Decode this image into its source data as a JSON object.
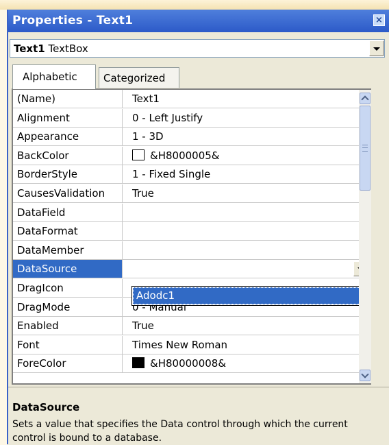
{
  "window": {
    "title": "Properties - Text1",
    "close_glyph": "×"
  },
  "object_selector": {
    "name": "Text1",
    "type": "TextBox"
  },
  "tabs": [
    {
      "label": "Alphabetic",
      "active": true
    },
    {
      "label": "Categorized",
      "active": false
    }
  ],
  "properties": [
    {
      "name": "(Name)",
      "value": "Text1"
    },
    {
      "name": "Alignment",
      "value": "0 - Left Justify"
    },
    {
      "name": "Appearance",
      "value": "1 - 3D"
    },
    {
      "name": "BackColor",
      "value": "&H8000005&",
      "swatch": "#ffffff"
    },
    {
      "name": "BorderStyle",
      "value": "1 - Fixed Single"
    },
    {
      "name": "CausesValidation",
      "value": "True"
    },
    {
      "name": "DataField",
      "value": ""
    },
    {
      "name": "DataFormat",
      "value": ""
    },
    {
      "name": "DataMember",
      "value": ""
    },
    {
      "name": "DataSource",
      "value": "",
      "selected": true
    },
    {
      "name": "DragIcon",
      "value": ""
    },
    {
      "name": "DragMode",
      "value": "0 - Manual"
    },
    {
      "name": "Enabled",
      "value": "True"
    },
    {
      "name": "Font",
      "value": "Times New Roman"
    },
    {
      "name": "ForeColor",
      "value": "&H80000008&",
      "swatch": "#000000"
    }
  ],
  "datasource_dropdown": {
    "selected_option": "Adodc1"
  },
  "description": {
    "title": "DataSource",
    "text": "Sets a value that specifies the Data control through which the current control is bound to a database."
  },
  "colors": {
    "title_bar": "#2c5ac8",
    "selection": "#316ac5",
    "panel": "#ece9d8"
  }
}
